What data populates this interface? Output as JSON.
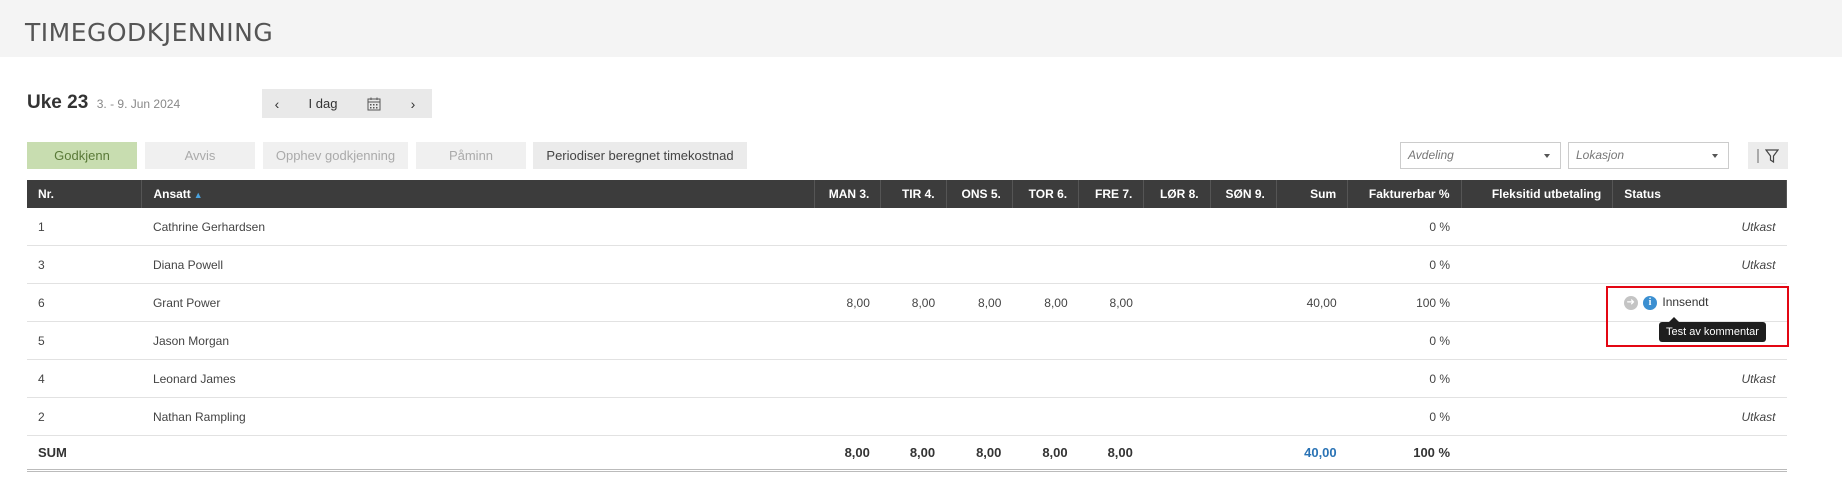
{
  "page": {
    "title": "TIMEGODKJENNING"
  },
  "week": {
    "label": "Uke 23",
    "range": "3. - 9. Jun 2024"
  },
  "datenav": {
    "prev": "‹",
    "today": "I dag",
    "next": "›"
  },
  "actions": {
    "approve": "Godkjenn",
    "reject": "Avvis",
    "revoke": "Opphev godkjenning",
    "remind": "Påminn",
    "accrue": "Periodiser beregnet timekostnad"
  },
  "filters": {
    "department": "Avdeling",
    "location": "Lokasjon"
  },
  "table": {
    "columns": [
      "Nr.",
      "Ansatt",
      "MAN 3.",
      "TIR 4.",
      "ONS 5.",
      "TOR 6.",
      "FRE 7.",
      "LØR 8.",
      "SØN 9.",
      "Sum",
      "Fakturerbar %",
      "Fleksitid utbetaling",
      "Status"
    ],
    "sort_indicator": "▲",
    "rows": [
      {
        "nr": "1",
        "name": "Cathrine Gerhardsen",
        "mon": "",
        "tue": "",
        "wed": "",
        "thu": "",
        "fri": "",
        "sat": "",
        "sun": "",
        "sum": "",
        "billable": "0 %",
        "flex": "",
        "status": "Utkast"
      },
      {
        "nr": "3",
        "name": "Diana Powell",
        "mon": "",
        "tue": "",
        "wed": "",
        "thu": "",
        "fri": "",
        "sat": "",
        "sun": "",
        "sum": "",
        "billable": "0 %",
        "flex": "",
        "status": "Utkast"
      },
      {
        "nr": "6",
        "name": "Grant Power",
        "mon": "8,00",
        "tue": "8,00",
        "wed": "8,00",
        "thu": "8,00",
        "fri": "8,00",
        "sat": "",
        "sun": "",
        "sum": "40,00",
        "billable": "100 %",
        "flex": "",
        "status": "Innsendt"
      },
      {
        "nr": "5",
        "name": "Jason Morgan",
        "mon": "",
        "tue": "",
        "wed": "",
        "thu": "",
        "fri": "",
        "sat": "",
        "sun": "",
        "sum": "",
        "billable": "0 %",
        "flex": "",
        "status": ""
      },
      {
        "nr": "4",
        "name": "Leonard James",
        "mon": "",
        "tue": "",
        "wed": "",
        "thu": "",
        "fri": "",
        "sat": "",
        "sun": "",
        "sum": "",
        "billable": "0 %",
        "flex": "",
        "status": "Utkast"
      },
      {
        "nr": "2",
        "name": "Nathan Rampling",
        "mon": "",
        "tue": "",
        "wed": "",
        "thu": "",
        "fri": "",
        "sat": "",
        "sun": "",
        "sum": "",
        "billable": "0 %",
        "flex": "",
        "status": "Utkast"
      }
    ],
    "sum_row": {
      "label": "SUM",
      "mon": "8,00",
      "tue": "8,00",
      "wed": "8,00",
      "thu": "8,00",
      "fri": "8,00",
      "sat": "",
      "sun": "",
      "sum": "40,00",
      "billable": "100 %"
    }
  },
  "tooltip": {
    "text": "Test av kommentar"
  },
  "icons": {
    "forward": "forward-arrow-icon",
    "info": "info-icon",
    "calendar": "calendar-icon",
    "filter": "filter-icon"
  },
  "colors": {
    "approve_bg": "#c8ddb0",
    "header_bg": "#3c3c3c",
    "link": "#2a73b5",
    "highlight": "#e30613"
  }
}
